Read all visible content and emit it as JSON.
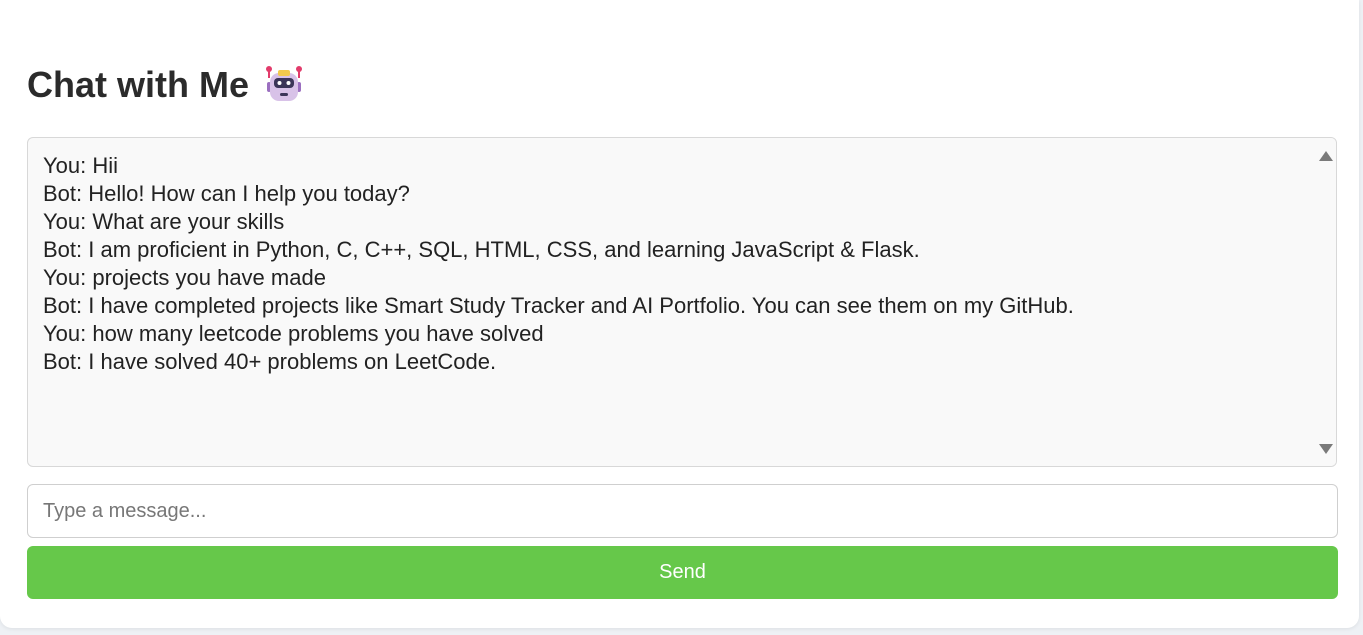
{
  "header": {
    "title": "Chat with Me",
    "icon": "robot-icon"
  },
  "chat": {
    "messages": [
      "You: Hii",
      "Bot: Hello! How can I help you today?",
      "You: What are your skills",
      "Bot: I am proficient in Python, C, C++, SQL, HTML, CSS, and learning JavaScript & Flask.",
      "You: projects you have made",
      "Bot: I have completed projects like Smart Study Tracker and AI Portfolio. You can see them on my GitHub.",
      "You: how many leetcode problems you have solved",
      "Bot: I have solved 40+ problems on LeetCode."
    ]
  },
  "input": {
    "placeholder": "Type a message...",
    "value": ""
  },
  "send": {
    "label": "Send"
  },
  "colors": {
    "accent": "#66c84a",
    "chat_bg": "#f9f9f9",
    "text": "#222222"
  }
}
